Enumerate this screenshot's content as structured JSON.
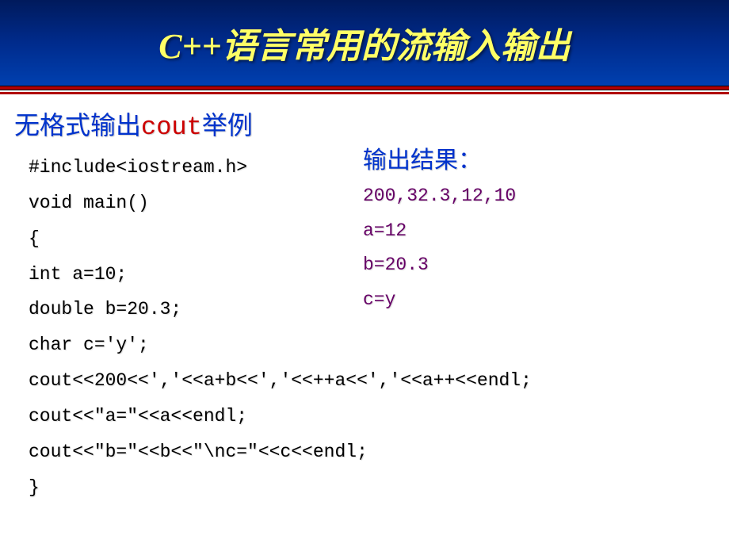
{
  "header": {
    "title": "C++语言常用的流输入输出"
  },
  "subtitle": {
    "part1": "无格式输出",
    "part2": "cout",
    "part3": "举例"
  },
  "code": {
    "line1": "#include<iostream.h>",
    "line2": "void main()",
    "line3": "{",
    "line4": "int a=10;",
    "line5": "double b=20.3;",
    "line6": "char c='y';",
    "line7": "cout<<200<<','<<a+b<<','<<++a<<','<<a++<<endl;",
    "line8": "cout<<\"a=\"<<a<<endl;",
    "line9": "cout<<\"b=\"<<b<<\"\\nc=\"<<c<<endl;",
    "line10": "}"
  },
  "output": {
    "title": "输出结果：",
    "line1": "200,32.3,12,10",
    "line2": "a=12",
    "line3": "b=20.3",
    "line4": "c=y"
  }
}
